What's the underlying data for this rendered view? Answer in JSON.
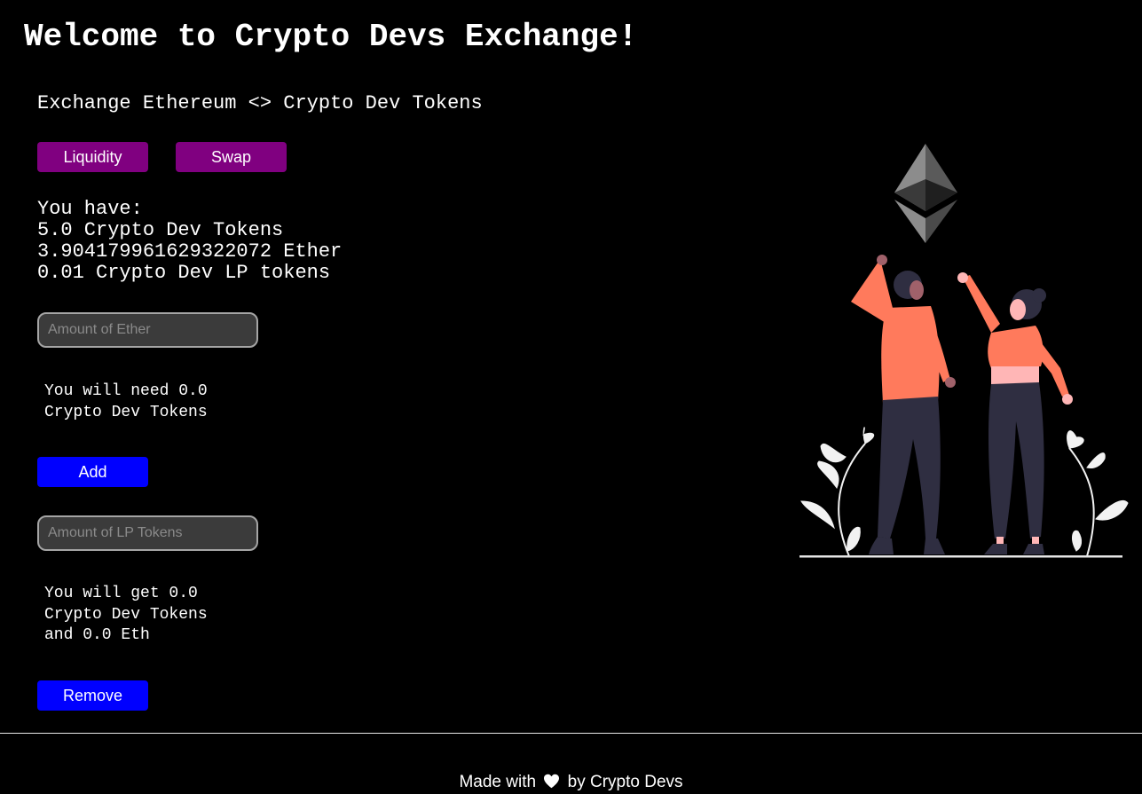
{
  "header": {
    "title": "Welcome to Crypto Devs Exchange!",
    "subtitle": "Exchange Ethereum <> Crypto Dev Tokens"
  },
  "tabs": {
    "liquidity_label": "Liquidity",
    "swap_label": "Swap"
  },
  "balances": {
    "heading": "You have:",
    "cd_tokens": "5.0 Crypto Dev Tokens",
    "ether": "3.904179961629322072 Ether",
    "lp_tokens": "0.01 Crypto Dev LP tokens"
  },
  "add_liquidity": {
    "ether_placeholder": "Amount of Ether",
    "need_line1": "You will need 0.0",
    "need_line2": "Crypto Dev Tokens",
    "add_label": "Add"
  },
  "remove_liquidity": {
    "lp_placeholder": "Amount of LP Tokens",
    "get_line1": "You will get 0.0",
    "get_line2": "Crypto Dev Tokens",
    "get_line3": "and 0.0 Eth",
    "remove_label": "Remove"
  },
  "footer": {
    "prefix": "Made with",
    "suffix": "by Crypto Devs",
    "heart_icon": "heart-icon"
  },
  "colors": {
    "background": "#000000",
    "tab_button": "#800080",
    "action_button": "#0000ff",
    "person_shirt": "#ff7a5c",
    "pants": "#2f2e41"
  }
}
